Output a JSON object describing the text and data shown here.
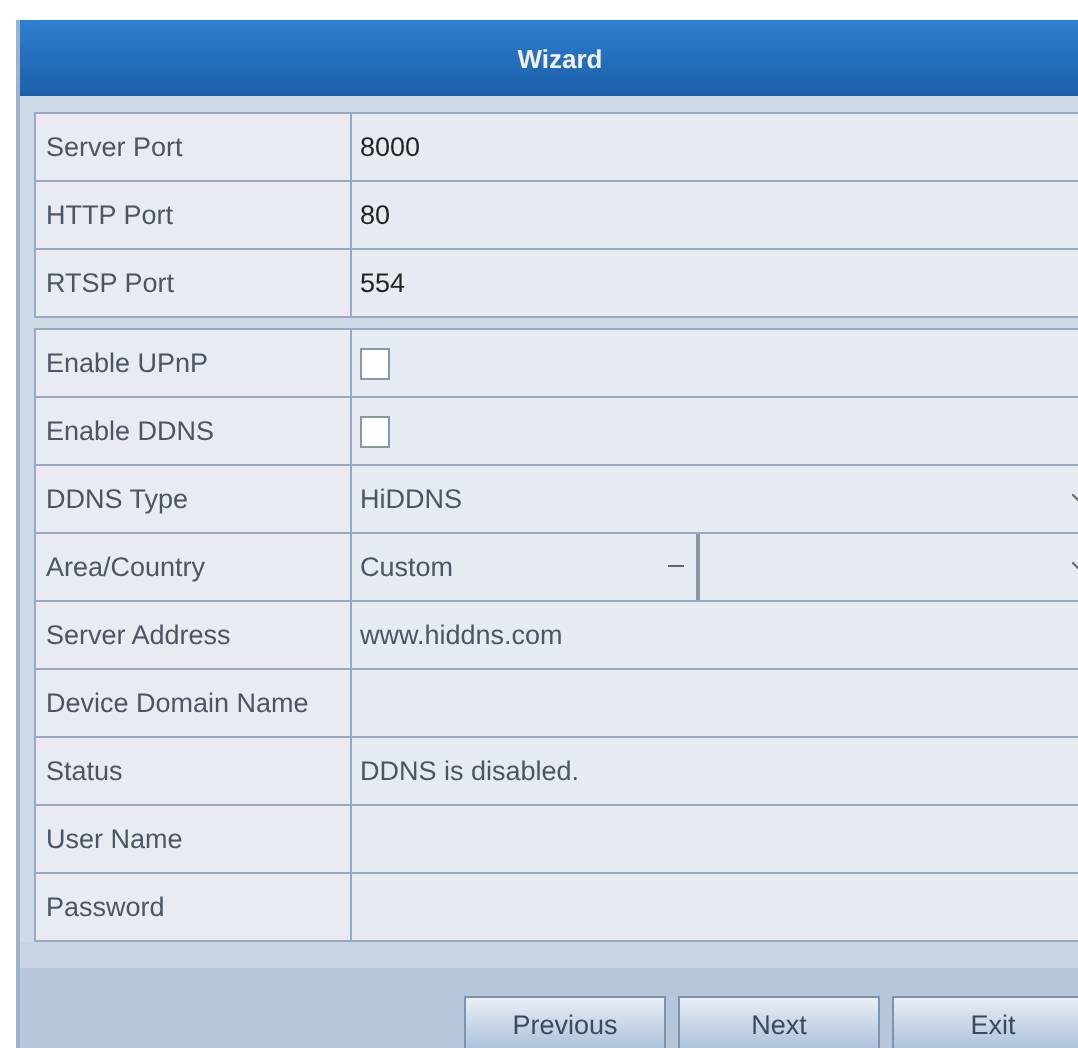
{
  "window": {
    "title": "Wizard"
  },
  "sections": [
    {
      "rows": [
        {
          "kind": "text",
          "label": "Server Port",
          "value": "8000"
        },
        {
          "kind": "text",
          "label": "HTTP Port",
          "value": "80"
        },
        {
          "kind": "text",
          "label": "RTSP Port",
          "value": "554"
        }
      ]
    },
    {
      "rows": [
        {
          "kind": "checkbox",
          "label": "Enable UPnP",
          "checked": false
        },
        {
          "kind": "checkbox",
          "label": "Enable DDNS",
          "checked": false
        },
        {
          "kind": "dropdown",
          "label": "DDNS Type",
          "value": "HiDDNS"
        },
        {
          "kind": "dual-dropdown",
          "label": "Area/Country",
          "value": "Custom"
        },
        {
          "kind": "text",
          "label": "Server Address",
          "value": "www.hiddns.com"
        },
        {
          "kind": "text",
          "label": "Device Domain Name"
        },
        {
          "kind": "text",
          "label": "Status",
          "value": "DDNS is disabled."
        },
        {
          "kind": "text",
          "label": "User Name"
        },
        {
          "kind": "text",
          "label": "Password"
        }
      ]
    }
  ],
  "buttons": [
    "Previous",
    "Next",
    "Exit"
  ]
}
